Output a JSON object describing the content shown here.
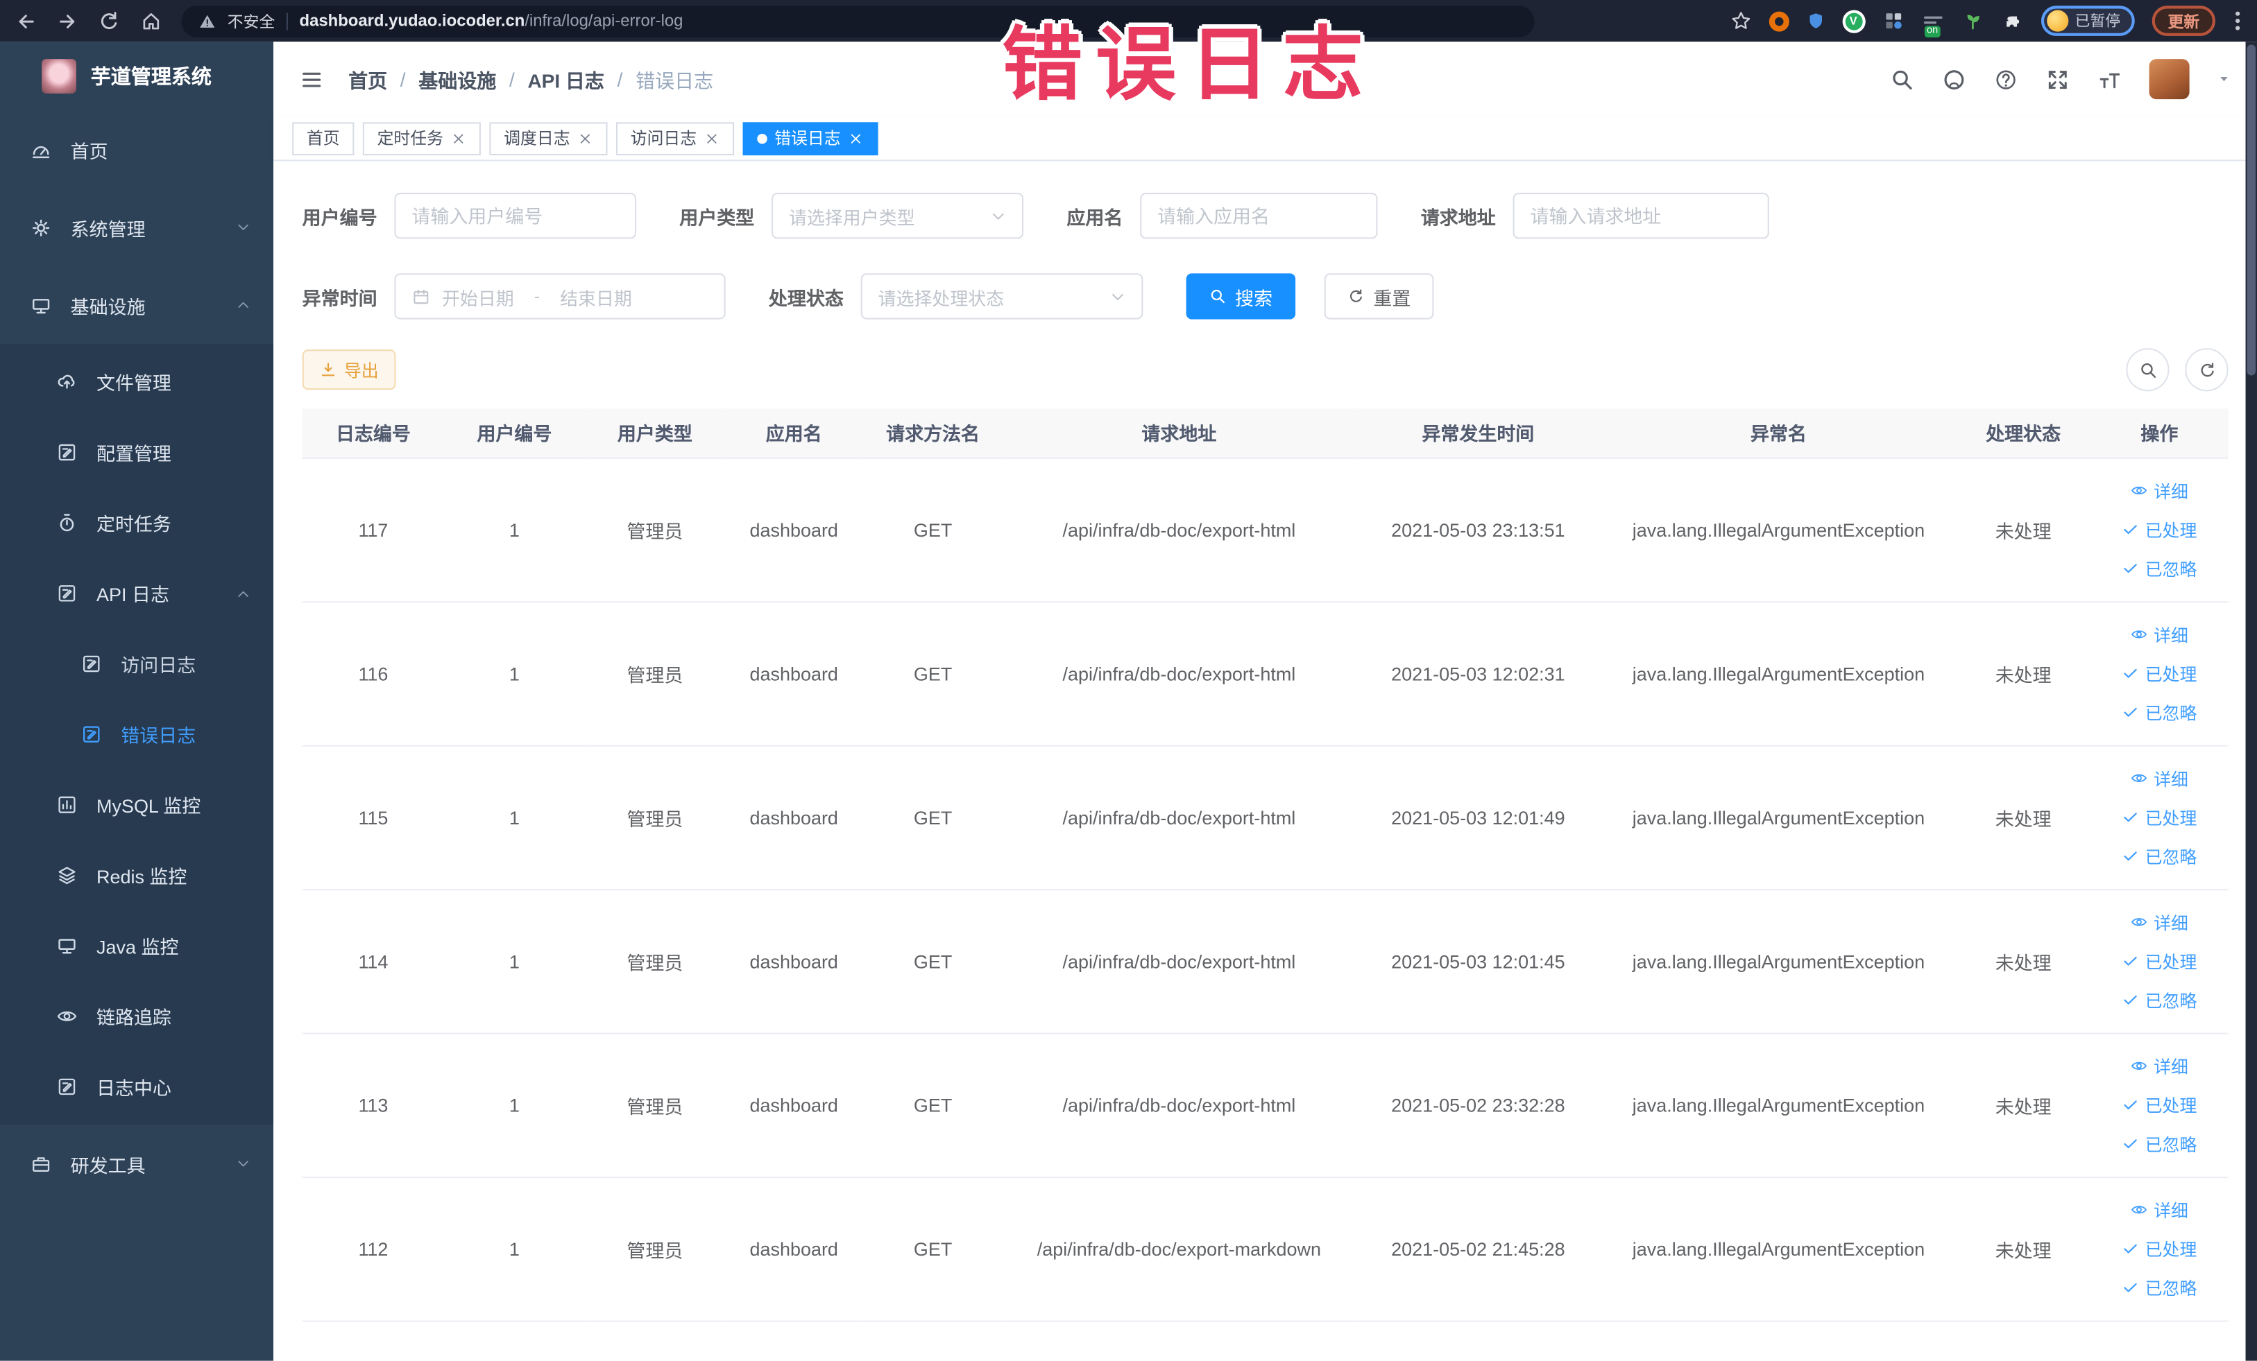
{
  "browser": {
    "security_label": "不安全",
    "url_host": "dashboard.yudao.iocoder.cn",
    "url_path": "/infra/log/api-error-log",
    "ext_badge_on": "on",
    "profile_status": "已暂停",
    "update_label": "更新"
  },
  "annotation": "错误日志",
  "sidebar": {
    "brand": "芋道管理系统",
    "menu": {
      "home": "首页",
      "system": "系统管理",
      "infra": "基础设施",
      "file": "文件管理",
      "config": "配置管理",
      "job": "定时任务",
      "api_log": "API 日志",
      "access_log": "访问日志",
      "error_log": "错误日志",
      "mysql": "MySQL 监控",
      "redis": "Redis 监控",
      "java": "Java 监控",
      "trace": "链路追踪",
      "log_center": "日志中心",
      "dev": "研发工具"
    }
  },
  "breadcrumb": {
    "items": [
      "首页",
      "基础设施",
      "API 日志",
      "错误日志"
    ],
    "separator": "/"
  },
  "tabs": [
    {
      "label": "首页"
    },
    {
      "label": "定时任务"
    },
    {
      "label": "调度日志"
    },
    {
      "label": "访问日志"
    },
    {
      "label": "错误日志"
    }
  ],
  "filters": {
    "user_id": {
      "label": "用户编号",
      "placeholder": "请输入用户编号"
    },
    "user_type": {
      "label": "用户类型",
      "placeholder": "请选择用户类型"
    },
    "app_name": {
      "label": "应用名",
      "placeholder": "请输入应用名"
    },
    "request_url": {
      "label": "请求地址",
      "placeholder": "请输入请求地址"
    },
    "exception_time": {
      "label": "异常时间",
      "start_placeholder": "开始日期",
      "separator": "-",
      "end_placeholder": "结束日期"
    },
    "process_status": {
      "label": "处理状态",
      "placeholder": "请选择处理状态"
    },
    "search_label": "搜索",
    "reset_label": "重置"
  },
  "toolbar": {
    "export_label": "导出"
  },
  "table": {
    "columns": [
      "日志编号",
      "用户编号",
      "用户类型",
      "应用名",
      "请求方法名",
      "请求地址",
      "异常发生时间",
      "异常名",
      "处理状态",
      "操作"
    ],
    "actions": {
      "detail": "详细",
      "processed": "已处理",
      "ignored": "已忽略"
    },
    "rows": [
      {
        "id": "117",
        "user_id": "1",
        "user_type": "管理员",
        "app_name": "dashboard",
        "method": "GET",
        "url": "/api/infra/db-doc/export-html",
        "time": "2021-05-03 23:13:51",
        "exception": "java.lang.IllegalArgumentException",
        "status": "未处理"
      },
      {
        "id": "116",
        "user_id": "1",
        "user_type": "管理员",
        "app_name": "dashboard",
        "method": "GET",
        "url": "/api/infra/db-doc/export-html",
        "time": "2021-05-03 12:02:31",
        "exception": "java.lang.IllegalArgumentException",
        "status": "未处理"
      },
      {
        "id": "115",
        "user_id": "1",
        "user_type": "管理员",
        "app_name": "dashboard",
        "method": "GET",
        "url": "/api/infra/db-doc/export-html",
        "time": "2021-05-03 12:01:49",
        "exception": "java.lang.IllegalArgumentException",
        "status": "未处理"
      },
      {
        "id": "114",
        "user_id": "1",
        "user_type": "管理员",
        "app_name": "dashboard",
        "method": "GET",
        "url": "/api/infra/db-doc/export-html",
        "time": "2021-05-03 12:01:45",
        "exception": "java.lang.IllegalArgumentException",
        "status": "未处理"
      },
      {
        "id": "113",
        "user_id": "1",
        "user_type": "管理员",
        "app_name": "dashboard",
        "method": "GET",
        "url": "/api/infra/db-doc/export-html",
        "time": "2021-05-02 23:32:28",
        "exception": "java.lang.IllegalArgumentException",
        "status": "未处理"
      },
      {
        "id": "112",
        "user_id": "1",
        "user_type": "管理员",
        "app_name": "dashboard",
        "method": "GET",
        "url": "/api/infra/db-doc/export-markdown",
        "time": "2021-05-02 21:45:28",
        "exception": "java.lang.IllegalArgumentException",
        "status": "未处理"
      }
    ]
  },
  "colors": {
    "primary": "#1890ff",
    "link": "#409eff",
    "warning": "#e6a23c",
    "annotation_pink": "#e83a5f",
    "sidebar_bg": "#2d4157",
    "submenu_bg": "#273a50"
  }
}
